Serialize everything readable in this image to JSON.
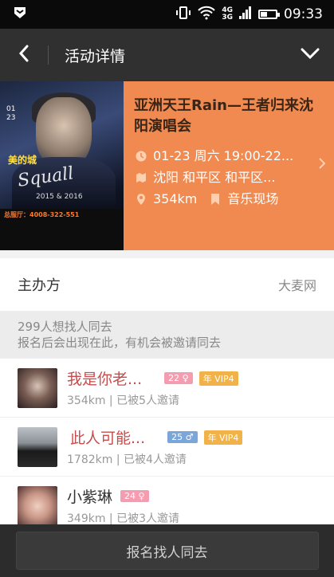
{
  "status_bar": {
    "time": "09:33",
    "network_top": "4G",
    "network_bottom": "3G",
    "app_icon": "shield-icon"
  },
  "header": {
    "title": "活动详情"
  },
  "event": {
    "title": "亚洲天王Rain—王者归来沈阳演唱会",
    "datetime": "01-23 周六 19:00-22...",
    "location": "沈阳 和平区 和平区...",
    "distance": "354km",
    "category": "音乐现场",
    "poster": {
      "date": "01\n23",
      "brand": "美的城",
      "title": "Squall",
      "subtitle": "2015 & 2016",
      "hotline": "总服厅：4008-322-551"
    }
  },
  "organizer": {
    "label": "主办方",
    "value": "大麦网"
  },
  "interest": {
    "count_text": "299人想找人同去",
    "hint": "报名后会出现在此，有机会被邀请同去"
  },
  "people": [
    {
      "name": "我是你老...",
      "age": "22",
      "gender": "female",
      "vip": "年 VIP4",
      "sub": "354km | 已被5人邀请"
    },
    {
      "name": "此人可能...",
      "age": "25",
      "gender": "male",
      "vip": "年 VIP4",
      "sub": "1782km | 已被4人邀请"
    },
    {
      "name": "小紫琳",
      "age": "24",
      "gender": "female",
      "vip": "",
      "sub": "349km | 已被3人邀请"
    }
  ],
  "bottom": {
    "button_label": "报名找人同去"
  },
  "colors": {
    "event_bg": "#f08a50",
    "name_red": "#c84c4c",
    "female_badge": "#f59cb1",
    "male_badge": "#7aa6d9",
    "vip_badge": "#f2b24a"
  }
}
